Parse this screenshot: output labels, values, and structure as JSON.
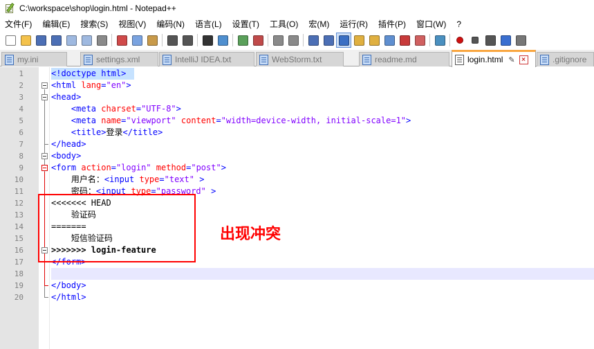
{
  "window": {
    "title": "C:\\workspace\\shop\\login.html - Notepad++"
  },
  "menu": [
    "文件(F)",
    "编辑(E)",
    "搜索(S)",
    "视图(V)",
    "编码(N)",
    "语言(L)",
    "设置(T)",
    "工具(O)",
    "宏(M)",
    "运行(R)",
    "插件(P)",
    "窗口(W)",
    "?"
  ],
  "toolbar_icons": [
    "new-file-icon",
    "open-file-icon",
    "save-icon",
    "save-all-icon",
    "close-icon",
    "close-all-icon",
    "print-icon",
    "cut-icon",
    "copy-icon",
    "paste-icon",
    "undo-icon",
    "redo-icon",
    "find-icon",
    "replace-icon",
    "zoom-in-icon",
    "zoom-out-icon",
    "sync-vertical-icon",
    "sync-horizontal-icon",
    "word-wrap-icon",
    "show-all-chars-icon",
    "indent-guide-icon",
    "doc-map-icon",
    "function-list-icon",
    "folder-workspace-icon",
    "monitoring-icon",
    "panel-icon",
    "view-icon",
    "record-macro-icon",
    "stop-record-icon",
    "play-macro-icon",
    "run-macro-multiple-icon",
    "save-macro-icon"
  ],
  "tabs": [
    {
      "label": "my.ini",
      "active": false
    },
    {
      "label": "settings.xml",
      "active": false
    },
    {
      "label": "IntelliJ IDEA.txt",
      "active": false
    },
    {
      "label": "WebStorm.txt",
      "active": false
    },
    {
      "label": "readme.md",
      "active": false
    },
    {
      "label": "login.html",
      "active": true
    },
    {
      "label": ".gitignore",
      "active": false
    }
  ],
  "editor": {
    "line_numbers": [
      "1",
      "2",
      "3",
      "4",
      "5",
      "6",
      "7",
      "8",
      "9",
      "10",
      "11",
      "12",
      "13",
      "14",
      "15",
      "16",
      "17",
      "18",
      "19",
      "20"
    ],
    "lines": [
      [
        {
          "t": "tag",
          "v": "<!doctype html>"
        }
      ],
      [
        {
          "t": "tag",
          "v": "<html "
        },
        {
          "t": "attr",
          "v": "lang"
        },
        {
          "t": "tag",
          "v": "="
        },
        {
          "t": "val",
          "v": "\"en\""
        },
        {
          "t": "tag",
          "v": ">"
        }
      ],
      [
        {
          "t": "tag",
          "v": "<head>"
        }
      ],
      [
        {
          "t": "text",
          "v": "    "
        },
        {
          "t": "tag",
          "v": "<meta "
        },
        {
          "t": "attr",
          "v": "charset"
        },
        {
          "t": "tag",
          "v": "="
        },
        {
          "t": "val",
          "v": "\"UTF-8\""
        },
        {
          "t": "tag",
          "v": ">"
        }
      ],
      [
        {
          "t": "text",
          "v": "    "
        },
        {
          "t": "tag",
          "v": "<meta "
        },
        {
          "t": "attr",
          "v": "name"
        },
        {
          "t": "tag",
          "v": "="
        },
        {
          "t": "val",
          "v": "\"viewport\""
        },
        {
          "t": "tag",
          "v": " "
        },
        {
          "t": "attr",
          "v": "content"
        },
        {
          "t": "tag",
          "v": "="
        },
        {
          "t": "val",
          "v": "\"width=device-width, initial-scale=1\""
        },
        {
          "t": "tag",
          "v": ">"
        }
      ],
      [
        {
          "t": "text",
          "v": "    "
        },
        {
          "t": "tag",
          "v": "<title>"
        },
        {
          "t": "text",
          "v": "登录"
        },
        {
          "t": "tag",
          "v": "</title>"
        }
      ],
      [
        {
          "t": "tag",
          "v": "</head>"
        }
      ],
      [
        {
          "t": "tag",
          "v": "<body>"
        }
      ],
      [
        {
          "t": "tag",
          "v": "<form "
        },
        {
          "t": "attr",
          "v": "action"
        },
        {
          "t": "tag",
          "v": "="
        },
        {
          "t": "val",
          "v": "\"login\""
        },
        {
          "t": "tag",
          "v": " "
        },
        {
          "t": "attr",
          "v": "method"
        },
        {
          "t": "tag",
          "v": "="
        },
        {
          "t": "val",
          "v": "\"post\""
        },
        {
          "t": "tag",
          "v": ">"
        }
      ],
      [
        {
          "t": "text",
          "v": "    用户名："
        },
        {
          "t": "tag",
          "v": "<input "
        },
        {
          "t": "attr",
          "v": "type"
        },
        {
          "t": "tag",
          "v": "="
        },
        {
          "t": "val",
          "v": "\"text\""
        },
        {
          "t": "tag",
          "v": " >"
        }
      ],
      [
        {
          "t": "text",
          "v": "    密码："
        },
        {
          "t": "tag",
          "v": "<input "
        },
        {
          "t": "attr",
          "v": "type"
        },
        {
          "t": "tag",
          "v": "="
        },
        {
          "t": "val",
          "v": "\"password\""
        },
        {
          "t": "tag",
          "v": " >"
        }
      ],
      [
        {
          "t": "text",
          "v": "<<<<<<< HEAD"
        }
      ],
      [
        {
          "t": "text",
          "v": "    验证码"
        }
      ],
      [
        {
          "t": "text",
          "v": "======="
        }
      ],
      [
        {
          "t": "text",
          "v": "    短信验证码"
        }
      ],
      [
        {
          "t": "bold",
          "v": ">>>>>>> login-feature"
        }
      ],
      [
        {
          "t": "tag",
          "v": "</form>"
        }
      ],
      [],
      [
        {
          "t": "tag",
          "v": "</body>"
        }
      ],
      [
        {
          "t": "tag",
          "v": "</html>"
        }
      ]
    ]
  },
  "annotation": {
    "label": "出现冲突",
    "color": "#ff0000"
  },
  "colors": {
    "tag": "#0000ff",
    "attribute": "#ff0000",
    "value": "#8000ff",
    "active_tab_accent": "#f9a640",
    "caret_line": "#e8e8ff"
  }
}
